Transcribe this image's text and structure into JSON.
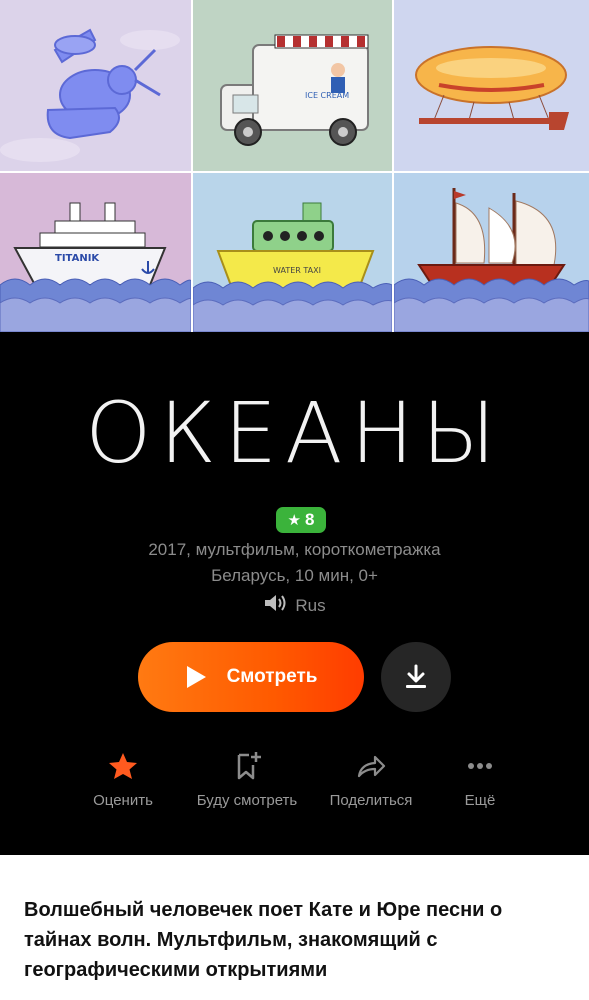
{
  "movie": {
    "title": "ОКЕАНЫ",
    "rating": "8",
    "meta_line1": "2017, мультфильм, короткометражка",
    "meta_line2": "Беларусь, 10 мин, 0+",
    "audio": "Rus",
    "description": "Волшебный человечек поет Кате и Юре песни о тайнах волн. Мультфильм, знакомящий с географическими открытиями"
  },
  "poster": {
    "ice_cream_sign": "ICE CREAM",
    "titanic_label": "TITANIK",
    "water_taxi_label": "WATER TAXI"
  },
  "buttons": {
    "watch": "Смотреть"
  },
  "actions": [
    {
      "label": "Оценить",
      "icon": "star-icon",
      "color": "#ff5a1f"
    },
    {
      "label": "Буду смотреть",
      "icon": "bookmark-plus-icon",
      "color": "#8c8c8c"
    },
    {
      "label": "Поделиться",
      "icon": "share-arrow-icon",
      "color": "#8c8c8c"
    },
    {
      "label": "Ещё",
      "icon": "more-dots-icon",
      "color": "#8c8c8c"
    }
  ],
  "colors": {
    "accent": "#ff5a00",
    "rating_badge": "#3bb33b",
    "background": "#000000"
  }
}
